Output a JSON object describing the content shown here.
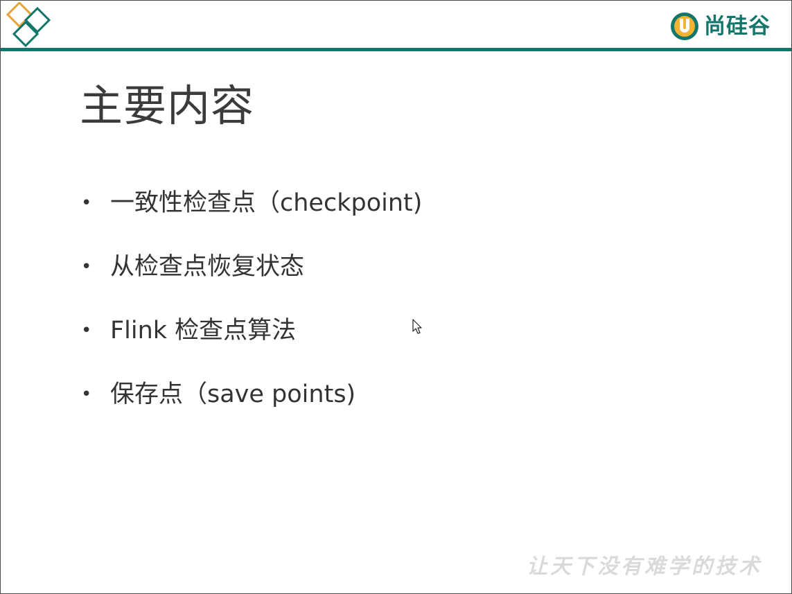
{
  "header": {
    "brand_name": "尚硅谷",
    "icons": {
      "corner_logo": "interlocking-diamonds-icon",
      "brand_mark": "u-circle-logo-icon"
    },
    "colors": {
      "accent": "#13766a",
      "diamond_orange": "#e8a23a",
      "diamond_teal": "#13766a"
    }
  },
  "slide": {
    "title": "主要内容",
    "bullet_symbol": "•",
    "bullets": [
      "一致性检查点（checkpoint)",
      "从检查点恢复状态",
      "Flink 检查点算法",
      "保存点（save points)"
    ]
  },
  "footer": {
    "watermark": "让天下没有难学的技术"
  }
}
